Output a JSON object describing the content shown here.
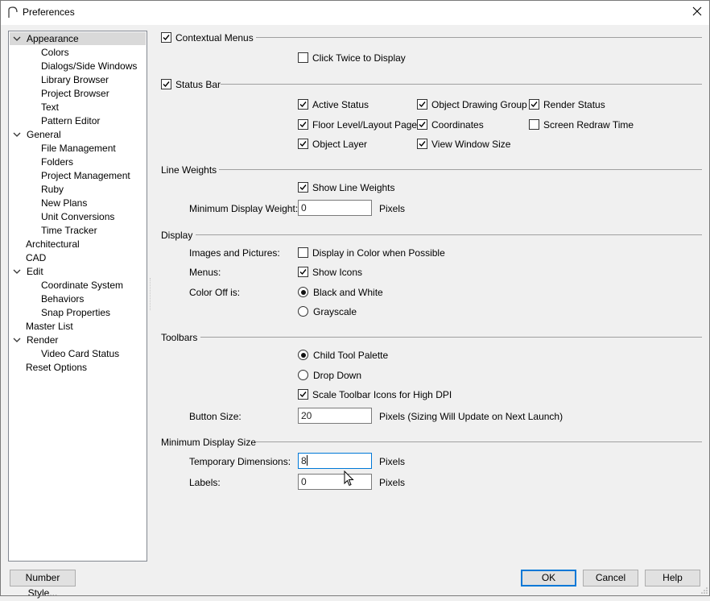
{
  "window": {
    "title": "Preferences"
  },
  "tree": {
    "items": [
      {
        "label": "Appearance",
        "chevron": true
      },
      {
        "label": "Colors"
      },
      {
        "label": "Dialogs/Side Windows"
      },
      {
        "label": "Library Browser"
      },
      {
        "label": "Project Browser"
      },
      {
        "label": "Text"
      },
      {
        "label": "Pattern Editor"
      },
      {
        "label": "General",
        "chevron": true
      },
      {
        "label": "File Management"
      },
      {
        "label": "Folders"
      },
      {
        "label": "Project Management"
      },
      {
        "label": "Ruby"
      },
      {
        "label": "New Plans"
      },
      {
        "label": "Unit Conversions"
      },
      {
        "label": "Time Tracker"
      },
      {
        "label": "Architectural"
      },
      {
        "label": "CAD"
      },
      {
        "label": "Edit",
        "chevron": true
      },
      {
        "label": "Coordinate System"
      },
      {
        "label": "Behaviors"
      },
      {
        "label": "Snap Properties"
      },
      {
        "label": "Master List"
      },
      {
        "label": "Render",
        "chevron": true
      },
      {
        "label": "Video Card Status"
      },
      {
        "label": "Reset Options"
      }
    ]
  },
  "contextual_menus": {
    "label": "Contextual Menus",
    "checked": true,
    "click_twice": {
      "label": "Click Twice to Display",
      "checked": false
    }
  },
  "status_bar": {
    "label": "Status Bar",
    "checked": true,
    "options": {
      "active_status": {
        "label": "Active Status",
        "checked": true
      },
      "object_drawing_group": {
        "label": "Object Drawing Group",
        "checked": true
      },
      "render_status": {
        "label": "Render Status",
        "checked": true
      },
      "floor_level": {
        "label": "Floor Level/Layout Page",
        "checked": true
      },
      "coordinates": {
        "label": "Coordinates",
        "checked": true
      },
      "screen_redraw": {
        "label": "Screen Redraw Time",
        "checked": false
      },
      "object_layer": {
        "label": "Object Layer",
        "checked": true
      },
      "view_window_size": {
        "label": "View Window Size",
        "checked": true
      }
    }
  },
  "line_weights": {
    "title": "Line Weights",
    "show": {
      "label": "Show Line Weights",
      "checked": true
    },
    "min_weight": {
      "label": "Minimum Display Weight:",
      "value": "0",
      "unit": "Pixels"
    }
  },
  "display": {
    "title": "Display",
    "images_label": "Images and Pictures:",
    "images_option": {
      "label": "Display in Color when Possible",
      "checked": false
    },
    "menus_label": "Menus:",
    "menus_option": {
      "label": "Show Icons",
      "checked": true
    },
    "color_off_label": "Color Off is:",
    "bw": {
      "label": "Black and White",
      "selected": true
    },
    "gray": {
      "label": "Grayscale",
      "selected": false
    }
  },
  "toolbars": {
    "title": "Toolbars",
    "child_palette": {
      "label": "Child Tool Palette",
      "selected": true
    },
    "drop_down": {
      "label": "Drop Down",
      "selected": false
    },
    "scale_icons": {
      "label": "Scale Toolbar Icons for High DPI",
      "checked": true
    },
    "button_size": {
      "label": "Button Size:",
      "value": "20",
      "unit": "Pixels (Sizing Will Update on Next Launch)"
    }
  },
  "min_display": {
    "title": "Minimum Display Size",
    "temp_dims": {
      "label": "Temporary Dimensions:",
      "value": "8",
      "unit": "Pixels"
    },
    "labels": {
      "label": "Labels:",
      "value": "0",
      "unit": "Pixels"
    }
  },
  "buttons": {
    "number_style": "Number Style...",
    "ok": "OK",
    "cancel": "Cancel",
    "help": "Help"
  },
  "colors": {
    "accent": "#0078d7",
    "selection": "#d9d9d9"
  }
}
